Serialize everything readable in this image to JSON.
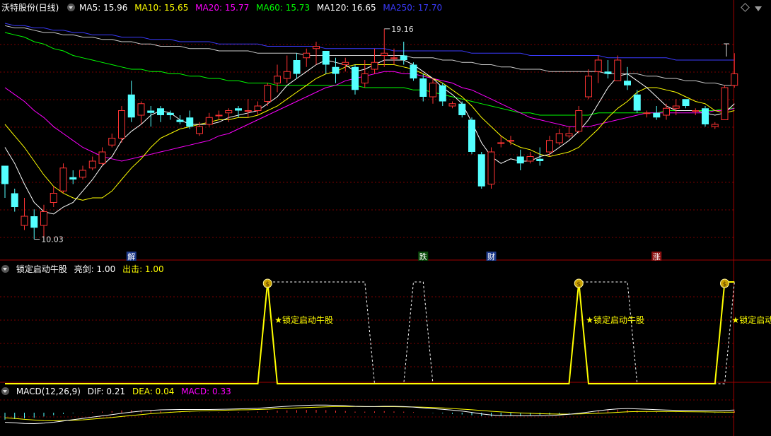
{
  "header": {
    "stock_title": "沃特股份(日线)",
    "ma": [
      {
        "label": "MA5: 15.96",
        "color": "#ffffff"
      },
      {
        "label": "MA10: 15.65",
        "color": "#ffff00"
      },
      {
        "label": "MA20: 15.77",
        "color": "#ff00ff"
      },
      {
        "label": "MA60: 15.73",
        "color": "#00ff00"
      },
      {
        "label": "MA120: 16.65",
        "color": "#ffffff"
      },
      {
        "label": "MA250: 17.70",
        "color": "#3b3bff"
      }
    ]
  },
  "annotations": {
    "high_label": "19.16",
    "low_label": "10.03",
    "markers": [
      {
        "text": "解",
        "bg": "#1e3a8a",
        "color": "#ffffff",
        "index": 13
      },
      {
        "text": "跌",
        "bg": "#0a4a0a",
        "color": "#ffffff",
        "index": 43
      },
      {
        "text": "财",
        "bg": "#1e3a8a",
        "color": "#ffffff",
        "index": 50
      },
      {
        "text": "涨",
        "bg": "#8a1010",
        "color": "#ffffff",
        "index": 67
      }
    ]
  },
  "indicator_panel": {
    "title": "锁定启动牛股",
    "param1": "亮剑: 1.00",
    "param2": "出击: 1.00",
    "signal_text": "★锁定启动牛股"
  },
  "macd_panel": {
    "title": "MACD(12,26,9)",
    "dif": "DIF: 0.21",
    "dea": "DEA: 0.04",
    "macd": "MACD: 0.33"
  },
  "colors": {
    "up": "#ff3333",
    "down": "#54ffff",
    "grid": "#7a0000",
    "signal_yellow": "#ffff00",
    "ma5": "#ffffff",
    "ma10": "#ffff00",
    "ma20": "#ff00ff",
    "ma60": "#00ff00",
    "ma120": "#cccccc",
    "ma250": "#3b3bff"
  },
  "chart_data": {
    "type": "candlestick",
    "ylim": [
      9.4,
      19.8
    ],
    "candles": [
      [
        13.2,
        12.4,
        13.2,
        11.8
      ],
      [
        12.0,
        11.4,
        12.2,
        11.2
      ],
      [
        10.6,
        11.0,
        11.8,
        10.4
      ],
      [
        11.0,
        10.5,
        11.3,
        10.0
      ],
      [
        10.6,
        11.2,
        11.5,
        10.1
      ],
      [
        11.6,
        12.0,
        12.3,
        11.4
      ],
      [
        12.1,
        13.1,
        13.3,
        12.0
      ],
      [
        12.7,
        12.6,
        13.0,
        12.4
      ],
      [
        12.7,
        13.0,
        13.2,
        12.6
      ],
      [
        13.1,
        13.4,
        13.6,
        13.0
      ],
      [
        13.3,
        13.8,
        14.0,
        13.2
      ],
      [
        14.1,
        14.4,
        14.6,
        14.0
      ],
      [
        14.4,
        15.6,
        15.8,
        14.2
      ],
      [
        16.3,
        15.3,
        16.9,
        15.1
      ],
      [
        15.4,
        15.9,
        16.0,
        15.0
      ],
      [
        15.6,
        15.5,
        15.8,
        14.9
      ],
      [
        15.7,
        15.4,
        15.8,
        15.1
      ],
      [
        15.5,
        15.4,
        15.6,
        15.2
      ],
      [
        15.2,
        15.1,
        15.4,
        15.0
      ],
      [
        15.3,
        14.9,
        15.6,
        14.8
      ],
      [
        14.6,
        14.9,
        15.1,
        14.5
      ],
      [
        15.0,
        15.3,
        15.5,
        14.9
      ],
      [
        15.4,
        15.4,
        15.6,
        15.2
      ],
      [
        15.5,
        15.6,
        15.7,
        15.1
      ],
      [
        15.7,
        15.6,
        15.8,
        15.3
      ],
      [
        15.6,
        15.6,
        16.1,
        15.3
      ],
      [
        15.6,
        15.8,
        16.0,
        15.4
      ],
      [
        16.0,
        16.7,
        16.8,
        15.8
      ],
      [
        16.8,
        17.1,
        17.6,
        16.4
      ],
      [
        17.0,
        17.3,
        18.0,
        16.8
      ],
      [
        17.8,
        17.2,
        18.1,
        17.0
      ],
      [
        17.9,
        18.1,
        18.3,
        17.5
      ],
      [
        18.3,
        18.4,
        18.6,
        17.6
      ],
      [
        18.2,
        17.6,
        18.2,
        17.2
      ],
      [
        17.5,
        17.2,
        17.9,
        16.8
      ],
      [
        17.6,
        17.7,
        17.9,
        17.3
      ],
      [
        17.5,
        16.5,
        17.6,
        16.3
      ],
      [
        16.8,
        17.2,
        17.8,
        16.6
      ],
      [
        17.4,
        17.7,
        18.3,
        17.2
      ],
      [
        18.0,
        18.1,
        19.16,
        17.5
      ],
      [
        17.9,
        17.9,
        18.3,
        17.6
      ],
      [
        18.0,
        17.8,
        18.6,
        17.6
      ],
      [
        17.6,
        17.0,
        17.7,
        16.9
      ],
      [
        17.0,
        16.2,
        17.2,
        16.0
      ],
      [
        16.2,
        16.8,
        17.0,
        15.9
      ],
      [
        16.7,
        16.0,
        16.8,
        15.8
      ],
      [
        15.8,
        15.9,
        16.0,
        15.7
      ],
      [
        15.9,
        15.4,
        16.0,
        15.3
      ],
      [
        15.2,
        13.8,
        15.3,
        13.7
      ],
      [
        13.7,
        12.3,
        13.8,
        12.2
      ],
      [
        12.4,
        13.8,
        14.0,
        12.2
      ],
      [
        14.2,
        14.2,
        14.5,
        14.0
      ],
      [
        14.3,
        14.3,
        14.5,
        14.1
      ],
      [
        13.6,
        13.3,
        13.9,
        13.0
      ],
      [
        13.4,
        13.6,
        13.8,
        13.3
      ],
      [
        13.5,
        13.4,
        14.0,
        13.2
      ],
      [
        13.8,
        14.3,
        14.5,
        13.6
      ],
      [
        14.2,
        14.6,
        14.8,
        14.1
      ],
      [
        14.5,
        14.6,
        14.9,
        14.4
      ],
      [
        14.7,
        15.6,
        15.8,
        14.6
      ],
      [
        16.2,
        17.1,
        17.4,
        16.1
      ],
      [
        17.3,
        17.8,
        18.0,
        16.8
      ],
      [
        17.3,
        17.2,
        17.8,
        17.0
      ],
      [
        16.9,
        17.8,
        18.0,
        16.9
      ],
      [
        16.9,
        16.7,
        17.5,
        16.5
      ],
      [
        16.3,
        15.6,
        16.5,
        15.5
      ],
      [
        15.5,
        15.5,
        15.6,
        15.3
      ],
      [
        15.5,
        15.3,
        15.8,
        15.2
      ],
      [
        15.4,
        15.7,
        15.9,
        15.2
      ],
      [
        15.7,
        15.8,
        16.1,
        15.4
      ],
      [
        16.1,
        15.8,
        16.1,
        15.7
      ],
      [
        15.6,
        15.6,
        15.7,
        15.4
      ],
      [
        15.7,
        15.0,
        15.8,
        14.9
      ],
      [
        14.9,
        15.0,
        15.1,
        14.8
      ],
      [
        15.2,
        16.6,
        16.7,
        15.2
      ],
      [
        16.7,
        17.2,
        18.1,
        16.6
      ]
    ],
    "ma5": [
      14.0,
      13.3,
      12.4,
      11.6,
      11.2,
      11.1,
      11.4,
      11.6,
      12.1,
      12.6,
      13.2,
      13.6,
      14.3,
      14.7,
      15.0,
      15.4,
      15.6,
      15.5,
      15.2,
      15.0,
      15.0,
      15.0,
      15.1,
      15.3,
      15.4,
      15.5,
      15.6,
      15.9,
      16.2,
      16.7,
      17.0,
      17.3,
      17.6,
      17.8,
      17.7,
      17.6,
      17.3,
      17.4,
      17.6,
      17.8,
      17.8,
      17.8,
      17.6,
      17.3,
      17.0,
      16.6,
      16.3,
      15.9,
      15.1,
      14.2,
      13.6,
      13.3,
      13.5,
      13.4,
      13.4,
      13.6,
      13.7,
      14.0,
      14.3,
      14.7,
      15.2,
      15.9,
      16.6,
      17.1,
      17.2,
      16.9,
      16.6,
      16.2,
      15.8,
      15.6,
      15.6,
      15.6,
      15.5,
      15.4,
      15.5,
      15.9
    ],
    "ma10": [
      15.0,
      14.5,
      14.0,
      13.4,
      12.8,
      12.3,
      12.0,
      11.8,
      11.7,
      11.8,
      11.8,
      12.1,
      12.6,
      13.1,
      13.5,
      14.0,
      14.4,
      14.6,
      14.8,
      14.9,
      15.0,
      15.1,
      15.2,
      15.2,
      15.3,
      15.3,
      15.4,
      15.6,
      15.8,
      16.1,
      16.4,
      16.7,
      17.0,
      17.2,
      17.3,
      17.5,
      17.6,
      17.6,
      17.6,
      17.6,
      17.6,
      17.5,
      17.4,
      17.2,
      17.0,
      16.8,
      16.5,
      16.2,
      15.8,
      15.3,
      14.9,
      14.5,
      14.2,
      14.0,
      13.9,
      13.7,
      13.6,
      13.7,
      13.8,
      14.0,
      14.4,
      14.8,
      15.3,
      15.7,
      16.0,
      16.4,
      16.6,
      16.6,
      16.5,
      16.4,
      16.2,
      16.0,
      15.9,
      15.6,
      15.5,
      15.6
    ],
    "ma20": [
      16.6,
      16.3,
      16.0,
      15.6,
      15.3,
      14.9,
      14.6,
      14.3,
      14.0,
      13.8,
      13.6,
      13.5,
      13.4,
      13.5,
      13.6,
      13.7,
      13.8,
      13.9,
      14.0,
      14.1,
      14.2,
      14.3,
      14.5,
      14.6,
      14.8,
      15.0,
      15.2,
      15.4,
      15.6,
      15.8,
      16.0,
      16.2,
      16.4,
      16.6,
      16.7,
      16.9,
      17.0,
      17.1,
      17.2,
      17.3,
      17.3,
      17.2,
      17.2,
      17.1,
      17.0,
      16.9,
      16.8,
      16.6,
      16.5,
      16.3,
      16.1,
      15.9,
      15.7,
      15.5,
      15.3,
      15.2,
      15.1,
      15.0,
      14.9,
      14.9,
      14.9,
      15.0,
      15.1,
      15.2,
      15.3,
      15.4,
      15.5,
      15.5,
      15.5,
      15.5,
      15.5,
      15.5,
      15.5,
      15.6,
      15.6,
      15.7
    ],
    "ma60": [
      19.0,
      18.9,
      18.8,
      18.6,
      18.5,
      18.3,
      18.2,
      18.0,
      17.9,
      17.8,
      17.7,
      17.6,
      17.5,
      17.4,
      17.4,
      17.3,
      17.3,
      17.2,
      17.2,
      17.1,
      17.1,
      17.0,
      17.0,
      16.9,
      16.9,
      16.8,
      16.8,
      16.8,
      16.7,
      16.7,
      16.7,
      16.7,
      16.7,
      16.7,
      16.7,
      16.7,
      16.7,
      16.6,
      16.6,
      16.6,
      16.6,
      16.6,
      16.5,
      16.5,
      16.4,
      16.3,
      16.2,
      16.1,
      16.0,
      15.9,
      15.8,
      15.7,
      15.6,
      15.5,
      15.5,
      15.4,
      15.4,
      15.4,
      15.4,
      15.4,
      15.4,
      15.5,
      15.5,
      15.5,
      15.5,
      15.5,
      15.5,
      15.5,
      15.6,
      15.6,
      15.6,
      15.6,
      15.6,
      15.6,
      15.7,
      15.7
    ],
    "ma120": [
      19.3,
      19.2,
      19.2,
      19.1,
      19.0,
      19.0,
      18.9,
      18.9,
      18.8,
      18.8,
      18.7,
      18.7,
      18.6,
      18.6,
      18.5,
      18.5,
      18.4,
      18.4,
      18.4,
      18.3,
      18.3,
      18.3,
      18.2,
      18.2,
      18.2,
      18.2,
      18.1,
      18.1,
      18.1,
      18.1,
      18.1,
      18.0,
      18.0,
      18.0,
      18.0,
      18.0,
      18.0,
      18.0,
      18.0,
      18.0,
      18.0,
      18.0,
      17.9,
      17.9,
      17.9,
      17.8,
      17.8,
      17.7,
      17.7,
      17.6,
      17.6,
      17.5,
      17.5,
      17.4,
      17.4,
      17.4,
      17.3,
      17.3,
      17.3,
      17.3,
      17.3,
      17.3,
      17.2,
      17.2,
      17.2,
      17.2,
      17.1,
      17.1,
      17.0,
      17.0,
      16.9,
      16.9,
      16.8,
      16.8,
      16.7,
      16.7
    ],
    "ma250": [
      19.4,
      19.3,
      19.3,
      19.2,
      19.2,
      19.1,
      19.1,
      19.0,
      19.0,
      18.9,
      18.9,
      18.9,
      18.8,
      18.8,
      18.8,
      18.7,
      18.7,
      18.7,
      18.6,
      18.6,
      18.6,
      18.6,
      18.5,
      18.5,
      18.5,
      18.5,
      18.5,
      18.4,
      18.4,
      18.4,
      18.4,
      18.4,
      18.4,
      18.3,
      18.3,
      18.3,
      18.3,
      18.3,
      18.3,
      18.3,
      18.2,
      18.2,
      18.2,
      18.2,
      18.2,
      18.2,
      18.2,
      18.2,
      18.1,
      18.1,
      18.1,
      18.1,
      18.1,
      18.1,
      18.0,
      18.0,
      18.0,
      18.0,
      18.0,
      18.0,
      18.0,
      18.0,
      17.9,
      17.9,
      17.9,
      17.9,
      17.9,
      17.9,
      17.9,
      17.8,
      17.8,
      17.8,
      17.8,
      17.8,
      17.8,
      17.8
    ],
    "signal_solid": [
      0,
      0,
      0,
      0,
      0,
      0,
      0,
      0,
      0,
      0,
      0,
      0,
      0,
      0,
      0,
      0,
      0,
      0,
      0,
      0,
      0,
      0,
      0,
      0,
      0,
      0,
      0,
      1,
      0,
      0,
      0,
      0,
      0,
      0,
      0,
      0,
      0,
      0,
      0,
      0,
      0,
      0,
      0,
      0,
      0,
      0,
      0,
      0,
      0,
      0,
      0,
      0,
      0,
      0,
      0,
      0,
      0,
      0,
      0,
      1,
      0,
      0,
      0,
      0,
      0,
      0,
      0,
      0,
      0,
      0,
      0,
      0,
      0,
      0,
      1,
      1
    ],
    "signal_dashed": [
      0,
      0,
      0,
      0,
      0,
      0,
      0,
      0,
      0,
      0,
      0,
      0,
      0,
      0,
      0,
      0,
      0,
      0,
      0,
      0,
      0,
      0,
      0,
      0,
      0,
      0,
      0,
      1,
      1,
      1,
      1,
      1,
      1,
      1,
      1,
      1,
      1,
      1,
      0,
      0,
      0,
      0,
      1,
      1,
      0,
      0,
      0,
      0,
      0,
      0,
      0,
      0,
      0,
      0,
      0,
      0,
      0,
      0,
      0,
      1,
      1,
      1,
      1,
      1,
      1,
      0,
      0,
      0,
      0,
      0,
      0,
      0,
      0,
      0,
      0,
      1
    ],
    "macd_hist": [
      -0.55,
      -0.5,
      -0.45,
      -0.4,
      -0.3,
      -0.2,
      -0.1,
      -0.05,
      0.02,
      0.05,
      0.08,
      0.12,
      0.18,
      0.2,
      0.18,
      0.15,
      0.12,
      0.08,
      0.05,
      0.03,
      0.02,
      0.03,
      0.04,
      0.05,
      0.06,
      0.07,
      0.08,
      0.12,
      0.15,
      0.18,
      0.2,
      0.22,
      0.22,
      0.2,
      0.16,
      0.13,
      0.08,
      0.08,
      0.1,
      0.12,
      0.1,
      0.08,
      0.04,
      0.0,
      -0.03,
      -0.06,
      -0.1,
      -0.14,
      -0.2,
      -0.28,
      -0.3,
      -0.28,
      -0.25,
      -0.22,
      -0.2,
      -0.18,
      -0.15,
      -0.1,
      -0.05,
      0.0,
      0.08,
      0.16,
      0.22,
      0.24,
      0.22,
      0.16,
      0.1,
      0.06,
      0.03,
      0.02,
      0.01,
      0.0,
      -0.02,
      -0.03,
      0.04,
      0.12
    ],
    "macd_dif": [
      -0.75,
      -0.8,
      -0.85,
      -0.86,
      -0.82,
      -0.75,
      -0.65,
      -0.55,
      -0.45,
      -0.35,
      -0.25,
      -0.15,
      -0.05,
      0.05,
      0.12,
      0.18,
      0.22,
      0.24,
      0.25,
      0.25,
      0.25,
      0.25,
      0.26,
      0.28,
      0.3,
      0.32,
      0.35,
      0.4,
      0.45,
      0.5,
      0.55,
      0.58,
      0.6,
      0.6,
      0.58,
      0.55,
      0.5,
      0.48,
      0.48,
      0.5,
      0.5,
      0.48,
      0.44,
      0.38,
      0.32,
      0.26,
      0.2,
      0.12,
      0.02,
      -0.1,
      -0.18,
      -0.22,
      -0.24,
      -0.25,
      -0.25,
      -0.24,
      -0.22,
      -0.18,
      -0.12,
      -0.05,
      0.05,
      0.15,
      0.24,
      0.3,
      0.32,
      0.3,
      0.27,
      0.24,
      0.21,
      0.19,
      0.18,
      0.17,
      0.16,
      0.16,
      0.18,
      0.21
    ],
    "macd_dea": [
      -0.4,
      -0.45,
      -0.52,
      -0.58,
      -0.62,
      -0.64,
      -0.63,
      -0.6,
      -0.56,
      -0.5,
      -0.44,
      -0.38,
      -0.3,
      -0.22,
      -0.15,
      -0.08,
      -0.02,
      0.03,
      0.08,
      0.11,
      0.14,
      0.16,
      0.18,
      0.2,
      0.22,
      0.23,
      0.25,
      0.28,
      0.31,
      0.34,
      0.37,
      0.4,
      0.43,
      0.46,
      0.48,
      0.49,
      0.49,
      0.48,
      0.47,
      0.47,
      0.47,
      0.46,
      0.45,
      0.43,
      0.4,
      0.37,
      0.33,
      0.28,
      0.23,
      0.17,
      0.11,
      0.06,
      0.02,
      -0.02,
      -0.05,
      -0.08,
      -0.1,
      -0.11,
      -0.11,
      -0.1,
      -0.08,
      -0.05,
      -0.01,
      0.03,
      0.07,
      0.09,
      0.1,
      0.1,
      0.1,
      0.09,
      0.08,
      0.07,
      0.06,
      0.05,
      0.04,
      0.04
    ]
  }
}
